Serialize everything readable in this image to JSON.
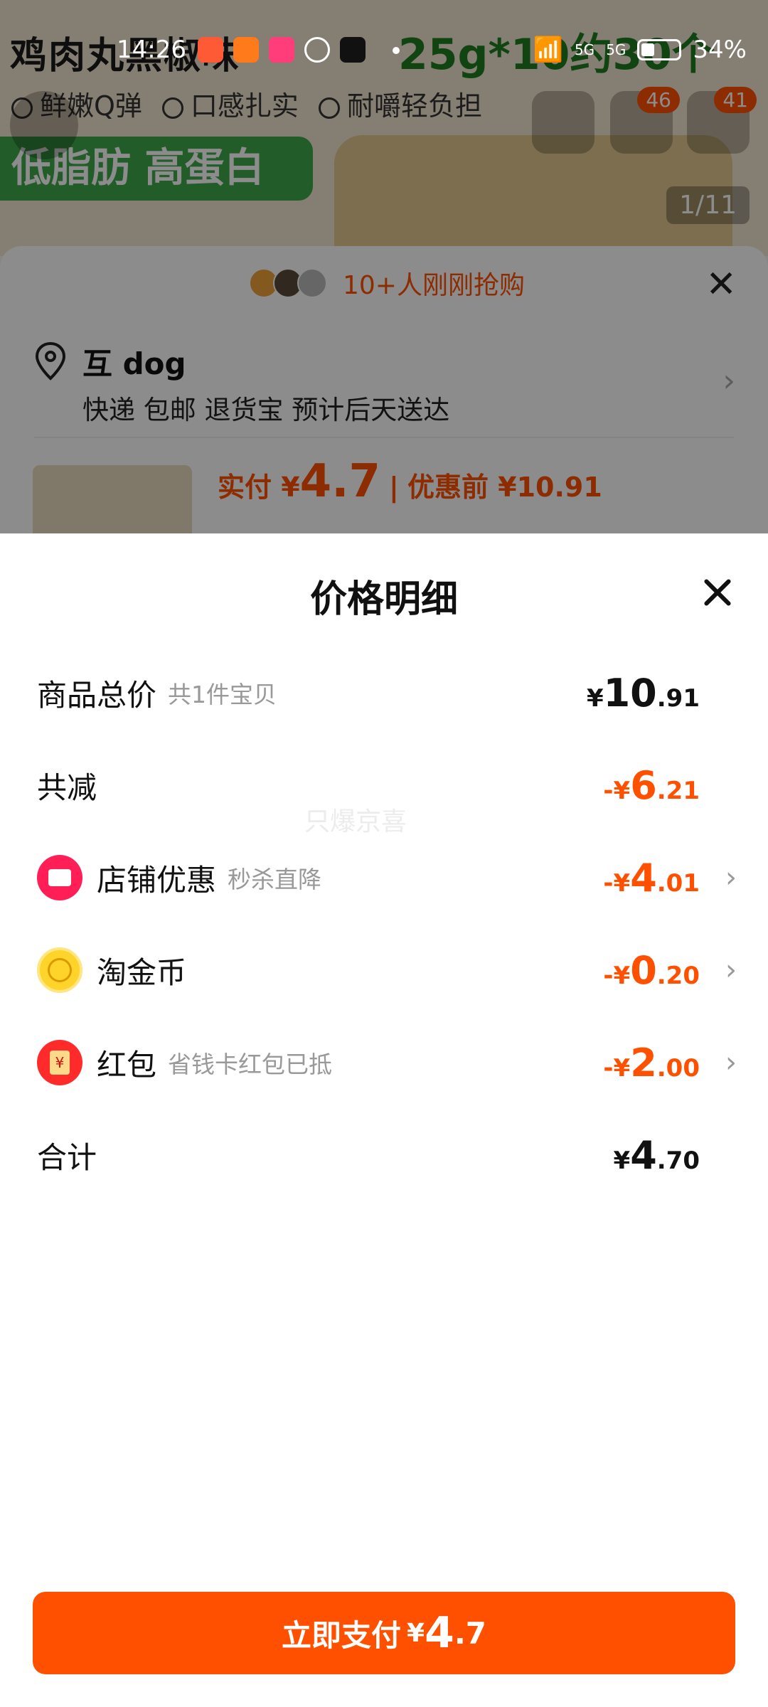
{
  "status_bar": {
    "time": "14:26",
    "network_1": "5G",
    "network_2": "5G",
    "battery": "34%"
  },
  "background_page": {
    "hero_title": "鸡肉丸黑椒味",
    "hero_spec": "25g*10约30个",
    "hero_checks": [
      "鲜嫩Q弹",
      "口感扎实",
      "耐嚼轻负担"
    ],
    "hero_banner": "低脂肪 高蛋白",
    "cart_badge": "46",
    "msg_badge": "41",
    "image_counter": "1/11",
    "buyers_text": "10+人刚刚抢购",
    "address_name": "互 dog",
    "address_detail": "快递 包邮 退货宝 预计后天送达",
    "price_prefix": "实付 ¥",
    "price_big": "4.7",
    "price_separator": "|",
    "price_before": "优惠前 ¥10.91"
  },
  "sheet": {
    "title": "价格明细",
    "watermark": "只爆京喜",
    "rows": [
      {
        "label": "商品总价",
        "sub": "共1件宝贝",
        "currency": "¥",
        "int": "10",
        "dec": ".91",
        "color": "#111111"
      },
      {
        "label": "共减",
        "sub": "",
        "currency": "-¥",
        "int": "6",
        "dec": ".21",
        "color": "#ff5000"
      },
      {
        "label": "店铺优惠",
        "sub": "秒杀直降",
        "currency": "-¥",
        "int": "4",
        "dec": ".01",
        "color": "#ff5000",
        "icon": "shop-icon"
      },
      {
        "label": "淘金币",
        "sub": "",
        "currency": "-¥",
        "int": "0",
        "dec": ".20",
        "color": "#ff5000",
        "icon": "gold-coin-icon"
      },
      {
        "label": "红包",
        "sub": "省钱卡红包已抵",
        "currency": "-¥",
        "int": "2",
        "dec": ".00",
        "color": "#ff5000",
        "icon": "red-packet-icon"
      },
      {
        "label": "合计",
        "sub": "",
        "currency": "¥",
        "int": "4",
        "dec": ".70",
        "color": "#111111"
      }
    ]
  },
  "pay_button": {
    "label": "立即支付",
    "currency": "¥",
    "int": "4",
    "dec": ".7"
  },
  "colors": {
    "accent": "#ff5000",
    "text": "#111111",
    "muted": "#999999"
  }
}
